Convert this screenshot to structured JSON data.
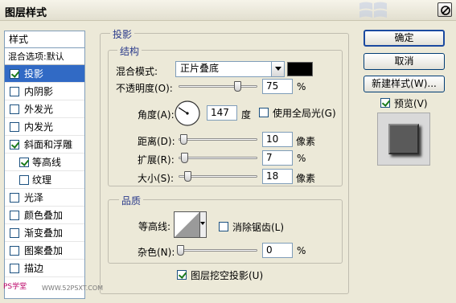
{
  "window": {
    "title": "图层样式"
  },
  "left_list": {
    "header": "样式",
    "blend_item": "混合选项:默认",
    "items": [
      {
        "label": "投影",
        "checked": true,
        "selected": true,
        "sub": false
      },
      {
        "label": "内阴影",
        "checked": false,
        "selected": false,
        "sub": false
      },
      {
        "label": "外发光",
        "checked": false,
        "selected": false,
        "sub": false
      },
      {
        "label": "内发光",
        "checked": false,
        "selected": false,
        "sub": false
      },
      {
        "label": "斜面和浮雕",
        "checked": true,
        "selected": false,
        "sub": false
      },
      {
        "label": "等高线",
        "checked": true,
        "selected": false,
        "sub": true
      },
      {
        "label": "纹理",
        "checked": false,
        "selected": false,
        "sub": true
      },
      {
        "label": "光泽",
        "checked": false,
        "selected": false,
        "sub": false
      },
      {
        "label": "颜色叠加",
        "checked": false,
        "selected": false,
        "sub": false
      },
      {
        "label": "渐变叠加",
        "checked": false,
        "selected": false,
        "sub": false
      },
      {
        "label": "图案叠加",
        "checked": false,
        "selected": false,
        "sub": false
      },
      {
        "label": "描边",
        "checked": false,
        "selected": false,
        "sub": false
      }
    ]
  },
  "panel": {
    "section_title": "投影",
    "structure": {
      "title": "结构",
      "blend_mode_label": "混合模式:",
      "blend_mode_value": "正片叠底",
      "shadow_color": "#000000",
      "opacity_label": "不透明度(O):",
      "opacity_value": "75",
      "opacity_unit": "%",
      "opacity_level": 0.75,
      "angle_label": "角度(A):",
      "angle_value": "147",
      "angle_unit": "度",
      "global_light_label": "使用全局光(G)",
      "global_light_checked": false,
      "distance_label": "距离(D):",
      "distance_value": "10",
      "distance_unit": "像素",
      "spread_label": "扩展(R):",
      "spread_value": "7",
      "spread_unit": "%",
      "size_label": "大小(S):",
      "size_value": "18",
      "size_unit": "像素"
    },
    "quality": {
      "title": "品质",
      "contour_label": "等高线:",
      "antialias_label": "消除锯齿(L)",
      "antialias_checked": false,
      "noise_label": "杂色(N):",
      "noise_value": "0",
      "noise_unit": "%"
    },
    "knockout_label": "图层挖空投影(U)",
    "knockout_checked": true
  },
  "buttons": {
    "ok": "确定",
    "cancel": "取消",
    "new_style": "新建样式(W)...",
    "preview_label": "预览(V)",
    "preview_checked": true
  },
  "watermark": {
    "left": "PS学堂",
    "site": "WWW.52PSXT.COM"
  }
}
